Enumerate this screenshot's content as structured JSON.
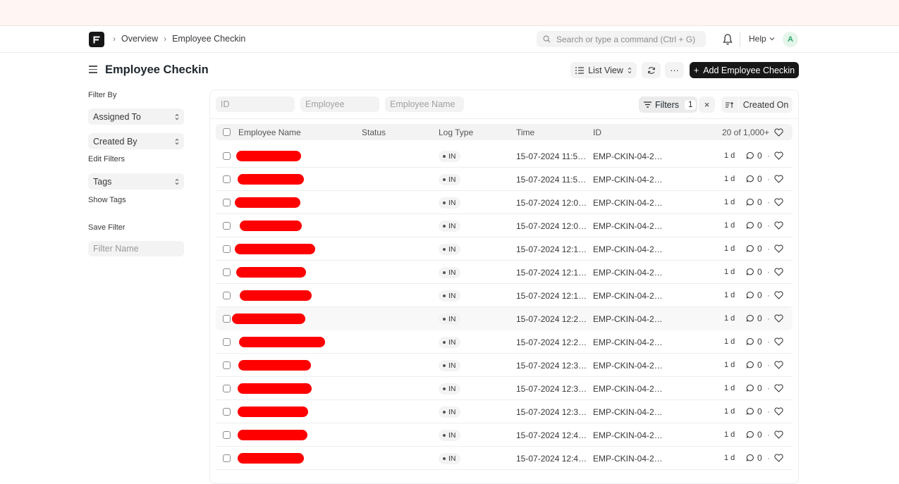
{
  "breadcrumb": [
    "Overview",
    "Employee Checkin"
  ],
  "search": {
    "placeholder": "Search or type a command (Ctrl + G)"
  },
  "help_label": "Help",
  "avatar_initial": "A",
  "page": {
    "title": "Employee Checkin",
    "list_view_label": "List View",
    "more_label": "···",
    "add_button_label": "Add Employee Checkin"
  },
  "sidebar": {
    "filter_by_label": "Filter By",
    "assigned_to": "Assigned To",
    "created_by": "Created By",
    "edit_filters": "Edit Filters",
    "tags": "Tags",
    "show_tags": "Show Tags",
    "save_filter_label": "Save Filter",
    "filter_name_placeholder": "Filter Name"
  },
  "filters": {
    "id_placeholder": "ID",
    "employee_placeholder": "Employee",
    "employee_name_placeholder": "Employee Name",
    "filters_label": "Filters",
    "filters_count": "1",
    "sort_label": "Created On"
  },
  "table": {
    "headers": {
      "employee_name": "Employee Name",
      "status": "Status",
      "log_type": "Log Type",
      "time": "Time",
      "id": "ID",
      "count": "20 of 1,000+"
    },
    "rows": [
      {
        "log_type": "IN",
        "time": "15-07-2024 11:5…",
        "id": "EMP-CKIN-04-2…",
        "age": "1 d",
        "comments": "0"
      },
      {
        "log_type": "IN",
        "time": "15-07-2024 11:5…",
        "id": "EMP-CKIN-04-2…",
        "age": "1 d",
        "comments": "0"
      },
      {
        "log_type": "IN",
        "time": "15-07-2024 12:0…",
        "id": "EMP-CKIN-04-2…",
        "age": "1 d",
        "comments": "0"
      },
      {
        "log_type": "IN",
        "time": "15-07-2024 12:0…",
        "id": "EMP-CKIN-04-2…",
        "age": "1 d",
        "comments": "0"
      },
      {
        "log_type": "IN",
        "time": "15-07-2024 12:1…",
        "id": "EMP-CKIN-04-2…",
        "age": "1 d",
        "comments": "0"
      },
      {
        "log_type": "IN",
        "time": "15-07-2024 12:1…",
        "id": "EMP-CKIN-04-2…",
        "age": "1 d",
        "comments": "0"
      },
      {
        "log_type": "IN",
        "time": "15-07-2024 12:1…",
        "id": "EMP-CKIN-04-2…",
        "age": "1 d",
        "comments": "0"
      },
      {
        "log_type": "IN",
        "time": "15-07-2024 12:2…",
        "id": "EMP-CKIN-04-2…",
        "age": "1 d",
        "comments": "0"
      },
      {
        "log_type": "IN",
        "time": "15-07-2024 12:2…",
        "id": "EMP-CKIN-04-2…",
        "age": "1 d",
        "comments": "0"
      },
      {
        "log_type": "IN",
        "time": "15-07-2024 12:3…",
        "id": "EMP-CKIN-04-2…",
        "age": "1 d",
        "comments": "0"
      },
      {
        "log_type": "IN",
        "time": "15-07-2024 12:3…",
        "id": "EMP-CKIN-04-2…",
        "age": "1 d",
        "comments": "0"
      },
      {
        "log_type": "IN",
        "time": "15-07-2024 12:3…",
        "id": "EMP-CKIN-04-2…",
        "age": "1 d",
        "comments": "0"
      },
      {
        "log_type": "IN",
        "time": "15-07-2024 12:4…",
        "id": "EMP-CKIN-04-2…",
        "age": "1 d",
        "comments": "0"
      },
      {
        "log_type": "IN",
        "time": "15-07-2024 12:4…",
        "id": "EMP-CKIN-04-2…",
        "age": "1 d",
        "comments": "0"
      }
    ]
  },
  "colors": {
    "redaction": "#ff0000",
    "primary_button": "#171717",
    "banner": "#fff5f3"
  }
}
